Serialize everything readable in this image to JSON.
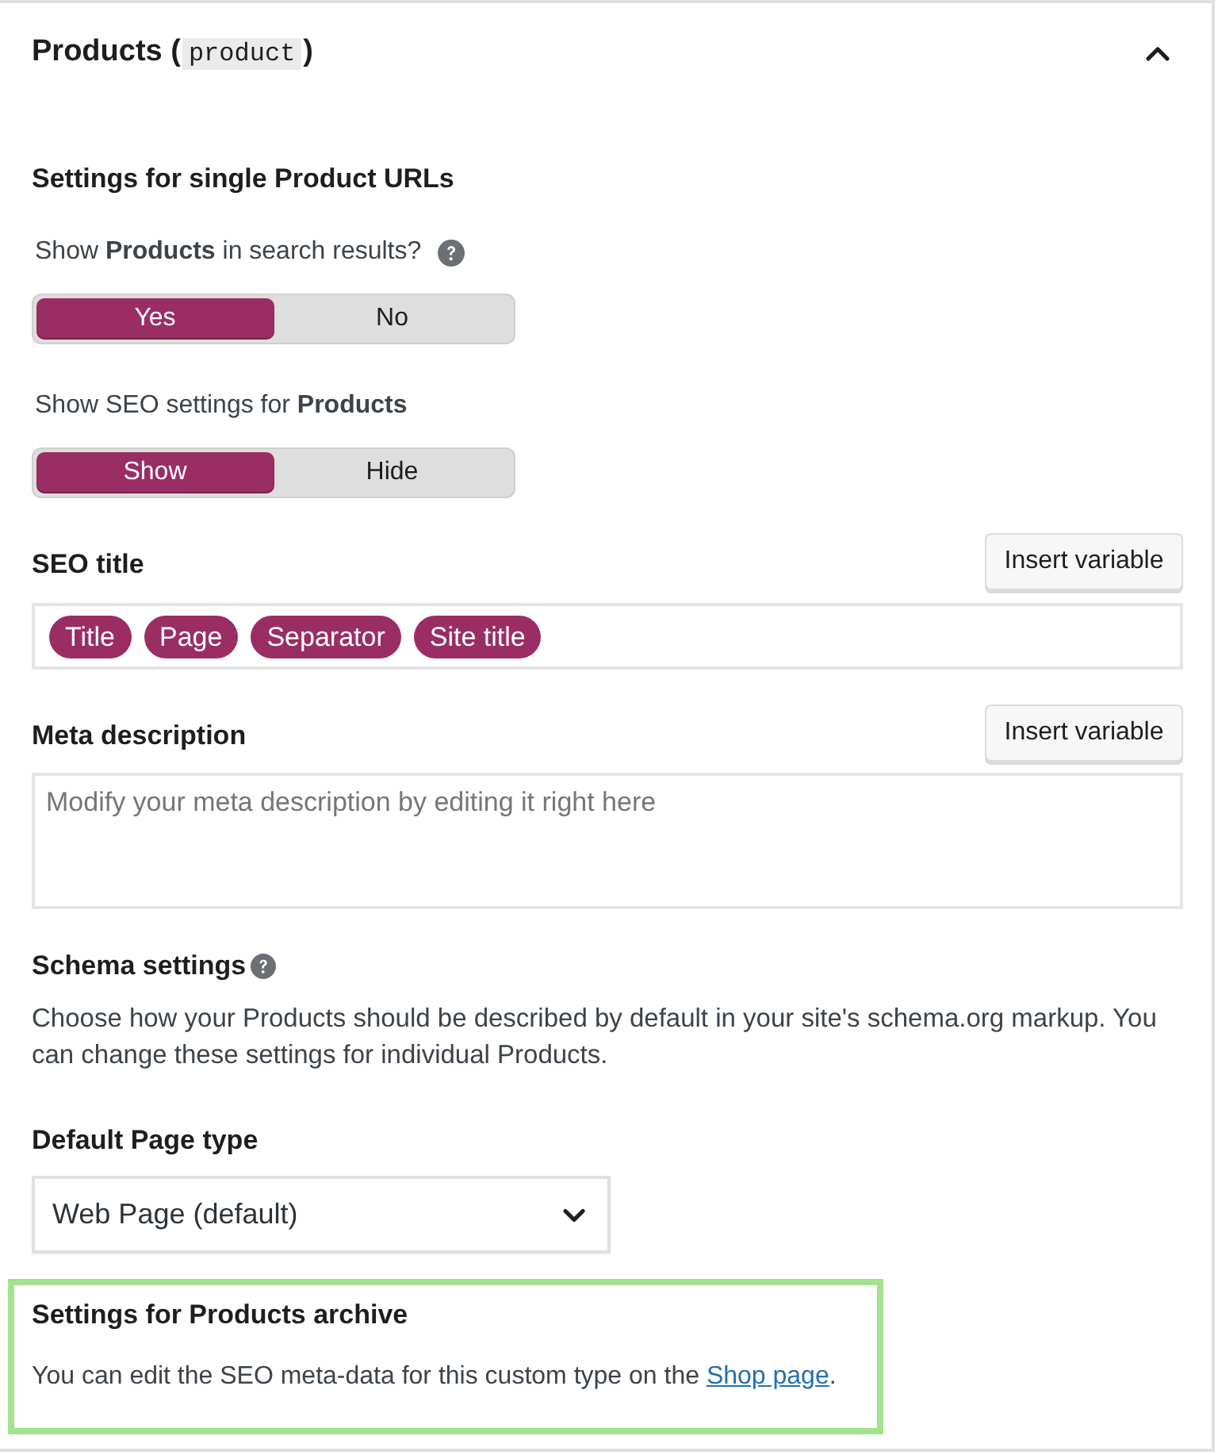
{
  "panel": {
    "title": "Products (",
    "slug": "product",
    "title_end": ")",
    "expanded": true
  },
  "single": {
    "heading": "Settings for single Product URLs",
    "toggles": [
      {
        "label": "Show **Products** in search results?",
        "help": true,
        "options": [
          {
            "label": "Yes",
            "selected": true
          },
          {
            "label": "No",
            "selected": false
          }
        ]
      },
      {
        "label": "Show SEO settings for **Products**",
        "help": false,
        "options": [
          {
            "label": "Show",
            "selected": true
          },
          {
            "label": "Hide",
            "selected": false
          }
        ]
      }
    ]
  },
  "fields": [
    {
      "kind": "variables",
      "label": "SEO title",
      "button": "Insert variable",
      "variables": [
        "Title",
        "Page",
        "Separator",
        "Site title"
      ]
    },
    {
      "kind": "textarea",
      "label": "Meta description",
      "button": "Insert variable",
      "placeholder": "Modify your meta description by editing it right here"
    }
  ],
  "schema": {
    "heading": "Schema settings",
    "help": true,
    "description": "Choose how your Products should be described by default in your site's schema.org markup. You can change these settings for individual Products.",
    "page_type": {
      "label": "Default Page type",
      "value": "Web Page (default)"
    }
  },
  "archive": {
    "heading": "Settings for Products archive",
    "text": "You can edit the SEO meta-data for this custom type on the",
    "link": "Shop page",
    "text_end": "."
  }
}
